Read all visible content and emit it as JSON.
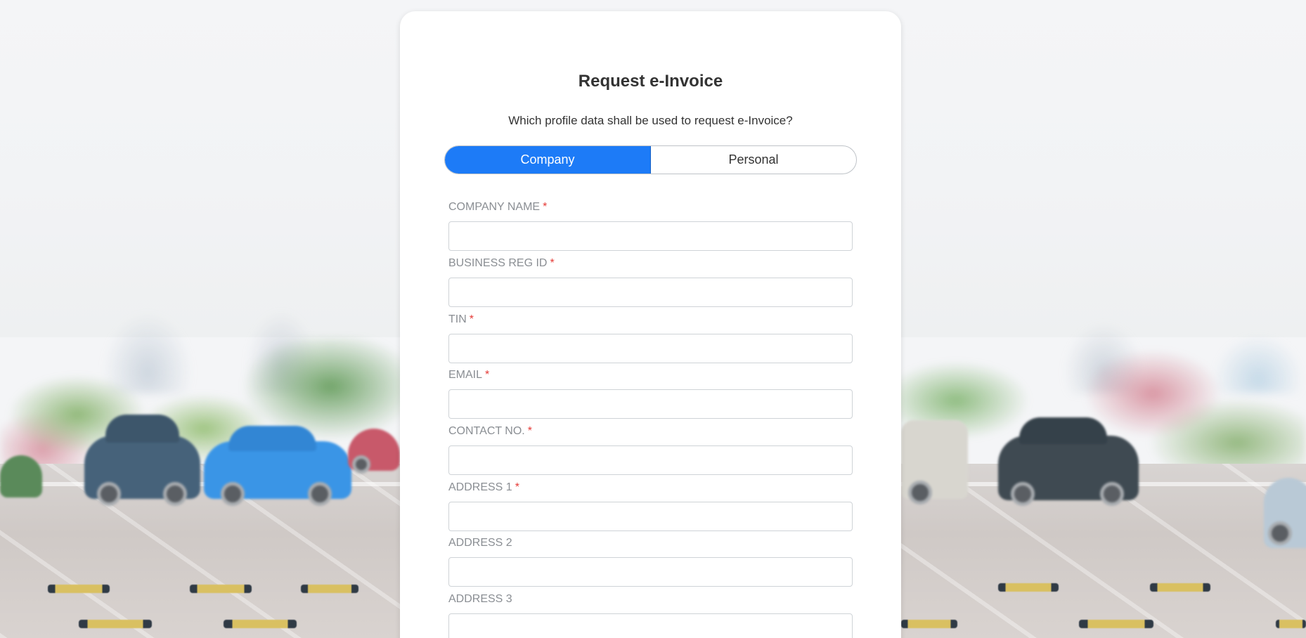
{
  "form": {
    "title": "Request e-Invoice",
    "subtitle": "Which profile data shall be used to request e-Invoice?",
    "toggle": {
      "options": [
        "Company",
        "Personal"
      ],
      "selected": "Company"
    },
    "required_marker": "*",
    "fields": [
      {
        "label": "COMPANY NAME",
        "required": true,
        "value": ""
      },
      {
        "label": "BUSINESS REG ID",
        "required": true,
        "value": ""
      },
      {
        "label": "TIN",
        "required": true,
        "value": ""
      },
      {
        "label": "EMAIL",
        "required": true,
        "value": ""
      },
      {
        "label": "CONTACT NO.",
        "required": true,
        "value": ""
      },
      {
        "label": "ADDRESS 1",
        "required": true,
        "value": ""
      },
      {
        "label": "ADDRESS 2",
        "required": false,
        "value": ""
      },
      {
        "label": "ADDRESS 3",
        "required": false,
        "value": ""
      }
    ]
  },
  "colors": {
    "accent": "#1d7bf7",
    "required": "#e53935",
    "label": "#8a8e93",
    "text": "#333333",
    "page_bg": "#f4f5f7"
  }
}
